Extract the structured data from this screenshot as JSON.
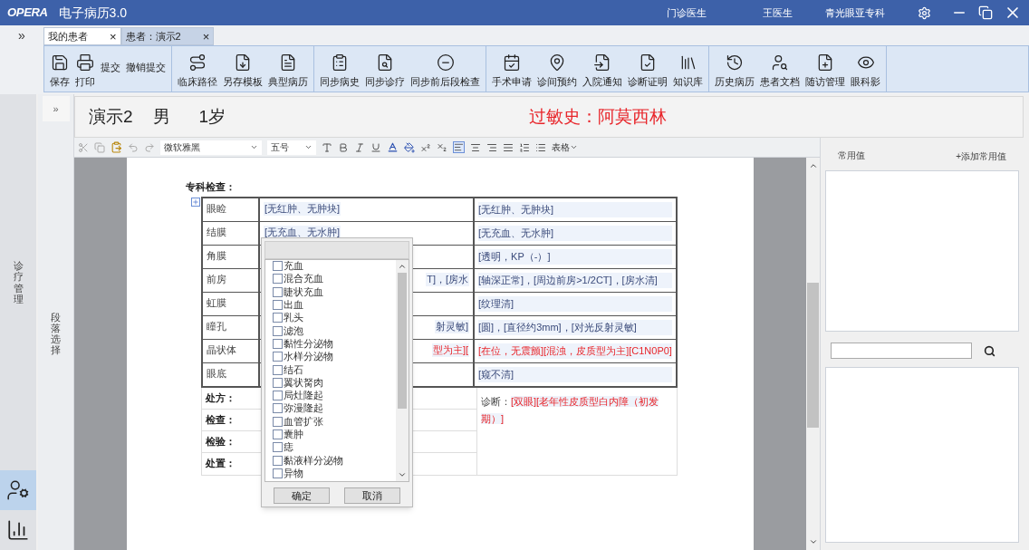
{
  "title_bar": {
    "logo": "OPERA",
    "title": "电子病历3.0",
    "role": "门诊医生",
    "user": "王医生",
    "department": "青光眼亚专科"
  },
  "tabs_toggle": "»",
  "tabs": [
    {
      "label": "我的患者",
      "close": "×",
      "selected": true
    },
    {
      "label": "患者：演示2",
      "close": "×",
      "selected": false
    }
  ],
  "toolbar": {
    "groups": [
      [
        {
          "label": "保存",
          "kind": "icon"
        },
        {
          "label": "打印",
          "kind": "icon"
        },
        {
          "label": "提交",
          "kind": "text"
        },
        {
          "label": "撤销提交",
          "kind": "text"
        }
      ],
      [
        {
          "label": "临床路径",
          "kind": "icon"
        },
        {
          "label": "另存模板",
          "kind": "icon"
        },
        {
          "label": "典型病历",
          "kind": "icon"
        }
      ],
      [
        {
          "label": "同步病史",
          "kind": "icon"
        },
        {
          "label": "同步诊疗",
          "kind": "icon"
        },
        {
          "label": "同步前后段检查",
          "kind": "icon"
        }
      ],
      [
        {
          "label": "手术申请",
          "kind": "icon"
        },
        {
          "label": "诊间预约",
          "kind": "icon"
        },
        {
          "label": "入院通知",
          "kind": "icon"
        },
        {
          "label": "诊断证明",
          "kind": "icon"
        },
        {
          "label": "知识库",
          "kind": "icon"
        }
      ],
      [
        {
          "label": "历史病历",
          "kind": "icon"
        },
        {
          "label": "患者文档",
          "kind": "icon"
        },
        {
          "label": "随访管理",
          "kind": "icon"
        },
        {
          "label": "眼科影",
          "kind": "icon"
        }
      ]
    ]
  },
  "left_sidebar": {
    "label": "诊疗管理"
  },
  "panel_toggle": "»",
  "section_sidebar": {
    "label": "段落选择"
  },
  "patient": {
    "name": "演示2",
    "sex": "男",
    "age": "1岁",
    "allergy": "过敏史：阿莫西林"
  },
  "format_bar": {
    "font": "微软雅黑",
    "size": "五号",
    "table_menu": "表格"
  },
  "document": {
    "heading": "专科检查：",
    "exam_rows": [
      {
        "label": "眼睑",
        "col_2": "[无红肿、无肿块]",
        "col_2_clipped": false,
        "col_3": "[无红肿、无肿块]",
        "alert": false
      },
      {
        "label": "结膜",
        "col_2": "[无充血、无水肿]",
        "col_2_clipped": false,
        "col_3": "[无充血、无水肿]",
        "alert": false
      },
      {
        "label": "角膜",
        "col_3": "[透明，KP（-）]",
        "alert": false
      },
      {
        "label": "前房",
        "col_2": "T]，[房水",
        "col_2_clipped": true,
        "col_3": "[轴深正常]，[周边前房>1/2CT]，[房水清]",
        "alert": false
      },
      {
        "label": "虹膜",
        "col_3": "[纹理清]",
        "alert": false
      },
      {
        "label": "瞳孔",
        "col_2": "射灵敏]",
        "col_2_clipped": true,
        "col_3": "[圆]，[直径约3mm]，[对光反射灵敏]",
        "alert": false
      },
      {
        "label": "晶状体",
        "col_2": "型为主][",
        "col_2_clipped": true,
        "col_3": "[在位，无震颤][混浊，皮质型为主][C1N0P0]",
        "alert": true
      },
      {
        "label": "眼底",
        "col_3": "[窥不清]",
        "alert": false
      }
    ],
    "orders": [
      "处方：",
      "检查：",
      "检验：",
      "处置："
    ],
    "diagnosis": {
      "label": "诊断：",
      "value": "[双眼][老年性皮质型白内障（初发期）]"
    }
  },
  "picker": {
    "options": [
      {
        "label": "充血",
        "checked": false
      },
      {
        "label": "混合充血",
        "checked": false
      },
      {
        "label": "睫状充血",
        "checked": false
      },
      {
        "label": "出血",
        "checked": false
      },
      {
        "label": "乳头",
        "checked": false
      },
      {
        "label": "滤泡",
        "checked": false
      },
      {
        "label": "黏性分泌物",
        "checked": false
      },
      {
        "label": "水样分泌物",
        "checked": false
      },
      {
        "label": "结石",
        "checked": false
      },
      {
        "label": "翼状胬肉",
        "checked": false
      },
      {
        "label": "局灶隆起",
        "checked": false
      },
      {
        "label": "弥漫隆起",
        "checked": false
      },
      {
        "label": "血管扩张",
        "checked": false
      },
      {
        "label": "囊肿",
        "checked": false
      },
      {
        "label": "痣",
        "checked": false
      },
      {
        "label": "黏液样分泌物",
        "checked": false
      },
      {
        "label": "异物",
        "checked": false
      }
    ],
    "buttons": [
      "确定",
      "取消"
    ]
  },
  "common_values": {
    "title": "常用值",
    "add": "+添加常用值"
  }
}
